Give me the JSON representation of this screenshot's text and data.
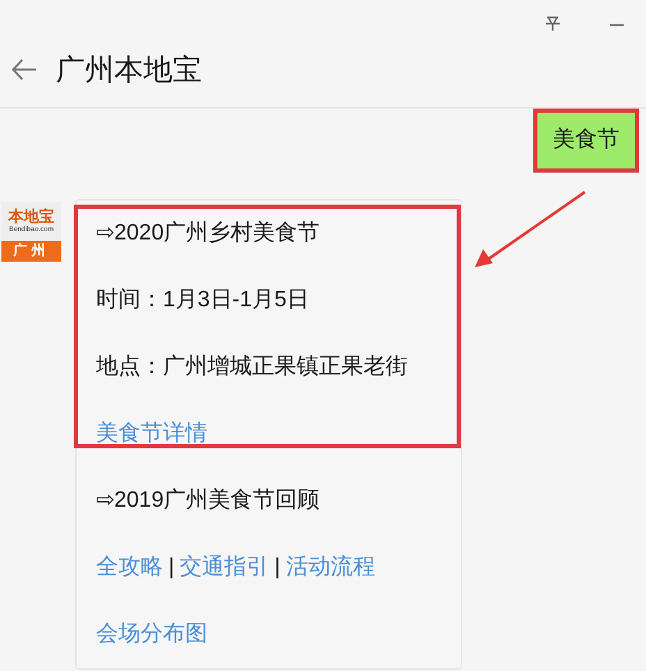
{
  "window": {
    "title": "广州本地宝"
  },
  "reply": {
    "text": "美食节",
    "highlighted": true
  },
  "avatar": {
    "brand": "本地宝",
    "site": "Bendibao.com",
    "city": "广州"
  },
  "message": {
    "sections": [
      {
        "highlighted": true,
        "blocks": [
          {
            "items": [
              {
                "kind": "text",
                "text": "⇨2020广州乡村美食节"
              }
            ]
          },
          {
            "items": [
              {
                "kind": "text",
                "text": "时间：1月3日-1月5日"
              }
            ]
          },
          {
            "items": [
              {
                "kind": "text",
                "text": "地点：广州增城正果镇正果老街"
              }
            ]
          },
          {
            "items": [
              {
                "kind": "link",
                "text": "美食节详情"
              }
            ]
          }
        ]
      },
      {
        "highlighted": false,
        "blocks": [
          {
            "items": [
              {
                "kind": "text",
                "text": "⇨2019广州美食节回顾"
              }
            ]
          },
          {
            "items": [
              {
                "kind": "link",
                "text": "全攻略"
              },
              {
                "kind": "sep",
                "text": "|"
              },
              {
                "kind": "link",
                "text": "交通指引"
              },
              {
                "kind": "sep",
                "text": "|"
              },
              {
                "kind": "link",
                "text": "活动流程"
              }
            ]
          },
          {
            "items": [
              {
                "kind": "link",
                "text": "会场分布图"
              }
            ]
          }
        ]
      }
    ]
  }
}
